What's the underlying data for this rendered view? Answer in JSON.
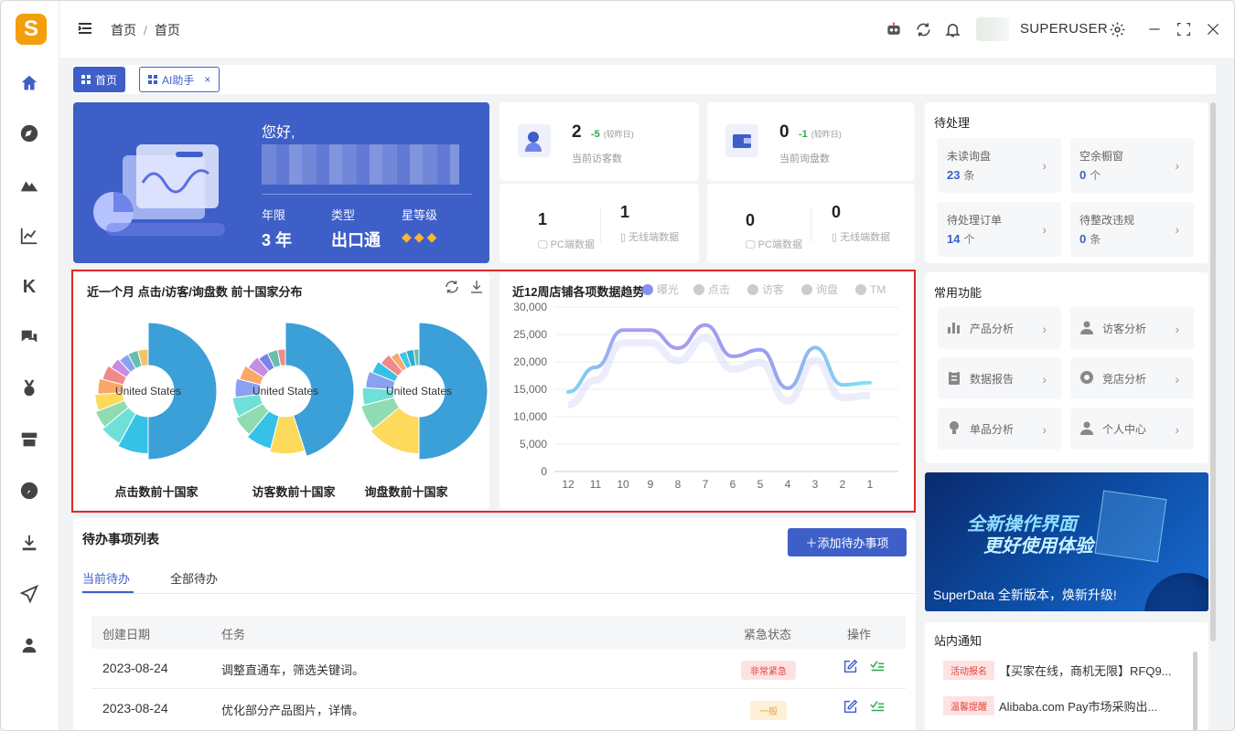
{
  "app": {
    "logo_letter": "S"
  },
  "breadcrumb": {
    "root": "首页",
    "current": "首页"
  },
  "user": {
    "name": "SUPERUSER"
  },
  "tabs": [
    {
      "label": "首页"
    },
    {
      "label": "AI助手",
      "close": "×"
    }
  ],
  "welcome": {
    "greeting": "您好,",
    "years_label": "年限",
    "years_value": "3 年",
    "type_label": "类型",
    "type_value": "出口通",
    "star_label": "星等级"
  },
  "stats": {
    "visitors": {
      "value": "2",
      "diff": "-5",
      "diff_note": "(较昨日)",
      "caption": "当前访客数",
      "pc": "1",
      "pc_label": "PC端数据",
      "mobile": "1",
      "mobile_label": "无线端数据"
    },
    "inquiries": {
      "value": "0",
      "diff": "-1",
      "diff_note": "(较昨日)",
      "caption": "当前询盘数",
      "pc": "0",
      "pc_label": "PC端数据",
      "mobile": "0",
      "mobile_label": "无线端数据"
    }
  },
  "pending": {
    "title": "待处理",
    "items": [
      {
        "label": "未读询盘",
        "value": "23",
        "unit": "条"
      },
      {
        "label": "空余橱窗",
        "value": "0",
        "unit": "个"
      },
      {
        "label": "待处理订单",
        "value": "14",
        "unit": "个"
      },
      {
        "label": "待整改违规",
        "value": "0",
        "unit": "条"
      }
    ]
  },
  "functions": {
    "title": "常用功能",
    "items": [
      {
        "label": "产品分析",
        "icon": "bar-chart-icon"
      },
      {
        "label": "访客分析",
        "icon": "person-icon"
      },
      {
        "label": "数据报告",
        "icon": "clipboard-icon"
      },
      {
        "label": "竞店分析",
        "icon": "aperture-icon"
      },
      {
        "label": "单品分析",
        "icon": "bulb-icon"
      },
      {
        "label": "个人中心",
        "icon": "person-icon"
      }
    ]
  },
  "banner": {
    "line1": "全新操作界面",
    "line2": "更好使用体验",
    "caption": "SuperData 全新版本，焕新升级!"
  },
  "notices": {
    "title": "站内通知",
    "items": [
      {
        "tag": "活动报名",
        "text": "【买家在线，商机无限】RFQ9..."
      },
      {
        "tag": "温馨提醒",
        "text": "Alibaba.com Pay市场采购出..."
      }
    ]
  },
  "country_chart": {
    "title": "近一个月 点击/访客/询盘数 前十国家分布",
    "center_label": "United States",
    "captions": [
      "点击数前十国家",
      "访客数前十国家",
      "询盘数前十国家"
    ]
  },
  "chart_data": {
    "type": "line",
    "title": "近12周店铺各项数据趋势",
    "x": [
      "12",
      "11",
      "10",
      "9",
      "8",
      "7",
      "6",
      "5",
      "4",
      "3",
      "2",
      "1"
    ],
    "series": [
      {
        "name": "曝光",
        "values": [
          14500,
          19000,
          25800,
          25800,
          22500,
          26700,
          21000,
          22200,
          15200,
          22600,
          15800,
          16200
        ]
      }
    ],
    "legend": [
      "曝光",
      "点击",
      "访客",
      "询盘",
      "TM"
    ],
    "yticks": [
      "0",
      "5,000",
      "10,000",
      "15,000",
      "20,000",
      "25,000",
      "30,000"
    ],
    "ylim": [
      0,
      30000
    ],
    "grid": true,
    "legend_position": "top-right"
  },
  "donuts": [
    {
      "name": "点击数前十国家",
      "values": [
        50,
        8,
        6,
        5,
        5,
        5,
        5,
        4,
        4,
        4,
        4
      ]
    },
    {
      "name": "访客数前十国家",
      "values": [
        45,
        9,
        7,
        6,
        6,
        6,
        5,
        5,
        4,
        4,
        3
      ]
    },
    {
      "name": "询盘数前十国家",
      "values": [
        50,
        14,
        7,
        5,
        5,
        4,
        4,
        3,
        3,
        3,
        2
      ]
    }
  ],
  "todo": {
    "title": "待办事项列表",
    "add_label": "＋添加待办事项",
    "tab_current": "当前待办",
    "tab_all": "全部待办",
    "headers": [
      "创建日期",
      "任务",
      "紧急状态",
      "操作"
    ],
    "rows": [
      {
        "date": "2023-08-24",
        "task": "调整直通车，筛选关键词。",
        "status": "非常紧急",
        "status_color": "#e0443e",
        "status_bg": "#fde2e2"
      },
      {
        "date": "2023-08-24",
        "task": "优化部分产品图片，详情。",
        "status": "一般",
        "status_color": "#e6a23c",
        "status_bg": "#fdf0d8"
      }
    ]
  },
  "colors": {
    "accent": "#3f5fc8",
    "highlight": "#e02828"
  }
}
